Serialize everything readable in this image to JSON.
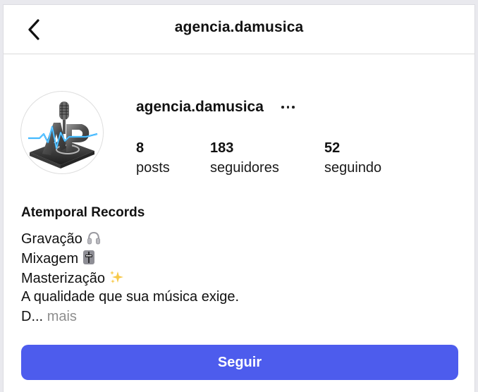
{
  "header": {
    "title": "agencia.damusica",
    "back_icon": "chevron-left-icon"
  },
  "profile": {
    "username": "agencia.damusica",
    "more_icon": "more-options-icon",
    "avatar_icon": "microphone-logo-icon",
    "stats": [
      {
        "value": "8",
        "label": "posts"
      },
      {
        "value": "183",
        "label": "seguidores"
      },
      {
        "value": "52",
        "label": "seguindo"
      }
    ]
  },
  "bio": {
    "name": "Atemporal Records",
    "lines": [
      {
        "text": "Gravação",
        "emoji": "headphones-icon"
      },
      {
        "text": "Mixagem",
        "emoji": "mixer-fader-icon"
      },
      {
        "text": "Masterização",
        "emoji": "sparkles-icon"
      },
      {
        "text": "A qualidade que sua música exige."
      }
    ],
    "truncated": "D...",
    "more_label": "mais"
  },
  "actions": {
    "follow_label": "Seguir"
  },
  "colors": {
    "button": "#4d5ced",
    "button_text": "#ffffff",
    "divider": "#dbdbdb",
    "muted": "#8e8e8e"
  }
}
